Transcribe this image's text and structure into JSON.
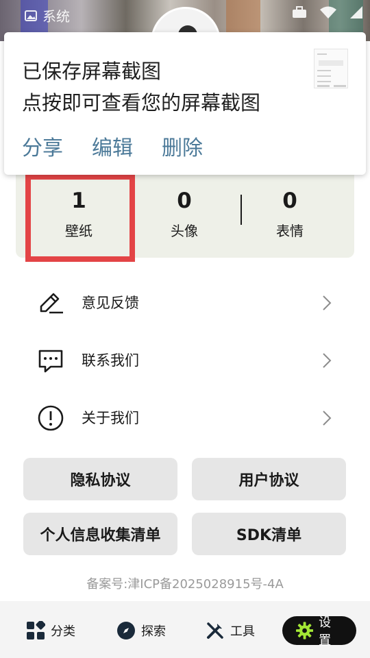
{
  "status_bar": {
    "app_label": "系统"
  },
  "notification": {
    "title": "已保存屏幕截图",
    "subtitle": "点按即可查看您的屏幕截图",
    "actions": [
      "分享",
      "编辑",
      "删除"
    ]
  },
  "stats": [
    {
      "value": "1",
      "label": "壁纸"
    },
    {
      "value": "0",
      "label": "头像"
    },
    {
      "value": "0",
      "label": "表情"
    }
  ],
  "menu": [
    {
      "label": "意见反馈",
      "icon": "edit-icon"
    },
    {
      "label": "联系我们",
      "icon": "message-icon"
    },
    {
      "label": "关于我们",
      "icon": "info-icon"
    }
  ],
  "buttons": {
    "privacy": "隐私协议",
    "user_agreement": "用户协议",
    "personal_info": "个人信息收集清单",
    "sdk": "SDK清单"
  },
  "icp": "备案号:津ICP备2025028915号-4A",
  "bottom_nav": [
    {
      "label": "分类",
      "icon": "grid-icon"
    },
    {
      "label": "探索",
      "icon": "compass-icon"
    },
    {
      "label": "工具",
      "icon": "tools-icon"
    },
    {
      "label": "设置",
      "icon": "gear-icon",
      "active": true
    }
  ],
  "colors": {
    "highlight": "#e34446",
    "notification_action": "#4c7a99",
    "stats_bg": "#eef0e8",
    "nav_active_bg": "#111111",
    "gear_accent": "#a3e635"
  }
}
